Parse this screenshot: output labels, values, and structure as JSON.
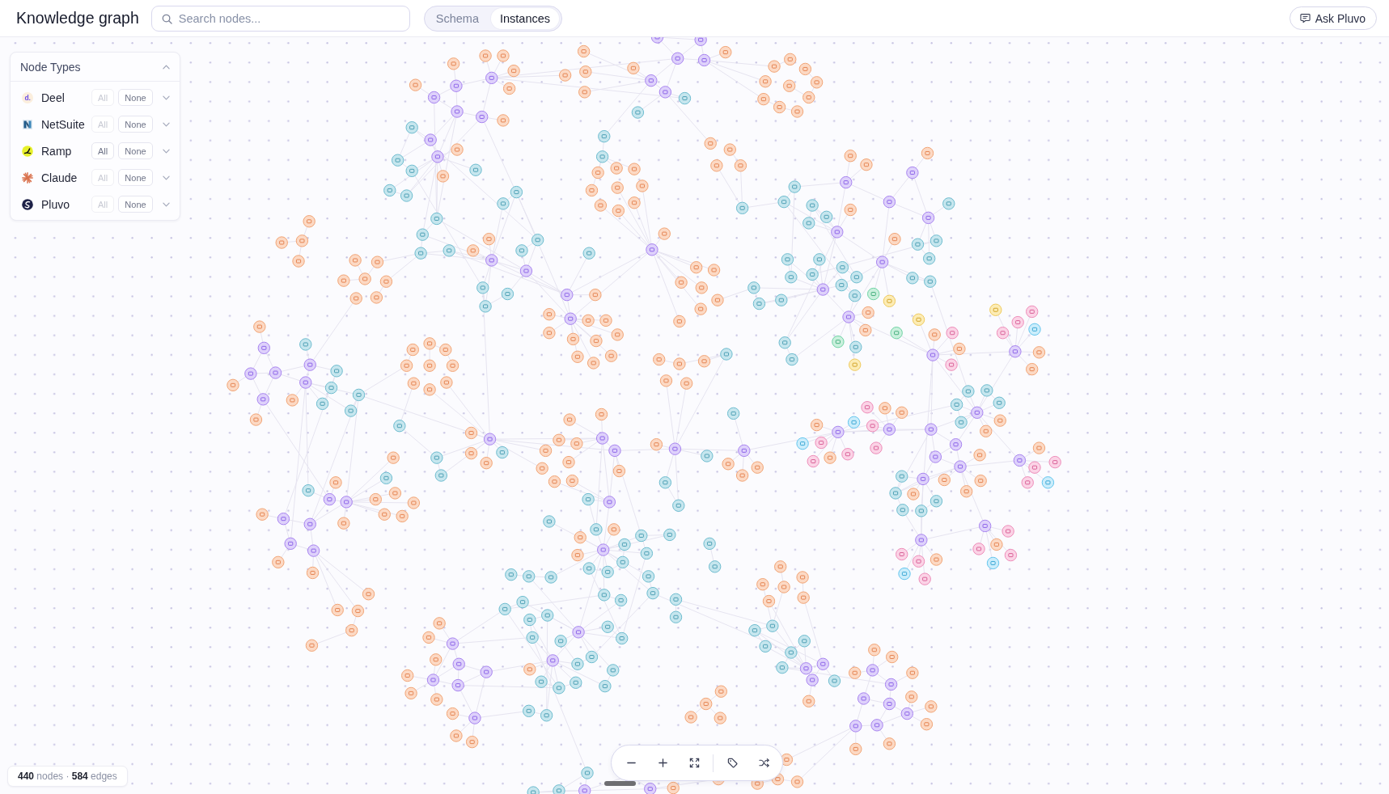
{
  "header": {
    "title": "Knowledge graph",
    "search": {
      "placeholder": "Search nodes..."
    },
    "view_tabs": [
      {
        "label": "Schema",
        "selected": false
      },
      {
        "label": "Instances",
        "selected": true
      }
    ],
    "ask_button": {
      "label": "Ask Pluvo"
    }
  },
  "node_types": {
    "title": "Node Types",
    "expanded": true,
    "items": [
      {
        "name": "Deel",
        "logo_text": "d.",
        "expanded": false,
        "buttons": [
          {
            "label": "All",
            "disabled": true
          },
          {
            "label": "None",
            "disabled": false
          }
        ]
      },
      {
        "name": "NetSuite",
        "expanded": false,
        "buttons": [
          {
            "label": "All",
            "disabled": true
          },
          {
            "label": "None",
            "disabled": false
          }
        ]
      },
      {
        "name": "Ramp",
        "expanded": false,
        "buttons": [
          {
            "label": "All",
            "disabled": false
          },
          {
            "label": "None",
            "disabled": false
          }
        ]
      },
      {
        "name": "Claude",
        "expanded": false,
        "buttons": [
          {
            "label": "All",
            "disabled": true
          },
          {
            "label": "None",
            "disabled": false
          }
        ]
      },
      {
        "name": "Pluvo",
        "expanded": false,
        "buttons": [
          {
            "label": "All",
            "disabled": true
          },
          {
            "label": "None",
            "disabled": false
          }
        ]
      }
    ]
  },
  "stats": {
    "text": "**440** nodes · **584** edges"
  }
}
